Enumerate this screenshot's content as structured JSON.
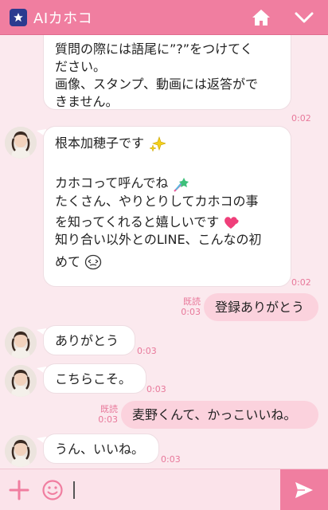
{
  "header": {
    "title": "AIカホコ",
    "logo_icon": "star-badge-icon",
    "home_icon": "home-icon",
    "collapse_icon": "chevron-down-icon"
  },
  "messages": {
    "m1": {
      "lines": [
        "質問の際には語尾に”?”をつけてく",
        "ださい。",
        "画像、スタンプ、動画には返答がで",
        "きません。"
      ],
      "time": "0:02"
    },
    "m2": {
      "line1": "根本加穂子です",
      "line2": "カホコって呼んでね",
      "line3": "たくさん、やりとりしてカホコの事",
      "line4": "を知ってくれると嬉しいです",
      "line5": "知り合い以外とのLINE、こんなの初",
      "line6": "めて",
      "time": "0:02"
    },
    "m3": {
      "read": "既読",
      "time": "0:03",
      "text": "登録ありがとう"
    },
    "m4": {
      "text": "ありがとう",
      "time": "0:03"
    },
    "m5": {
      "text": "こちらこそ。",
      "time": "0:03"
    },
    "m6": {
      "read": "既読",
      "time": "0:03",
      "text": "麦野くんて、かっこいいね。"
    },
    "m7": {
      "text": "うん、いいね。",
      "time": "0:03"
    }
  },
  "input": {
    "plus_icon": "plus-icon",
    "emoji_icon": "smiley-icon",
    "send_icon": "send-arrow-icon"
  },
  "colors": {
    "accent": "#f07ea0",
    "background": "#fbe9ee",
    "outgoing_bubble": "#fbd2dd",
    "timestamp": "#e8789a"
  }
}
